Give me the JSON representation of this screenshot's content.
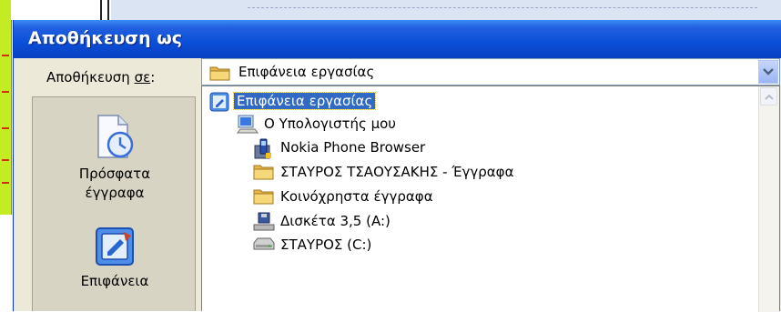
{
  "dialog": {
    "title": "Αποθήκευση ως",
    "save_in": {
      "label_prefix": "Αποθήκευση ",
      "label_accel": "σε",
      "label_suffix": ":",
      "selected_value": "Επιφάνεια εργασίας"
    }
  },
  "places": [
    {
      "label_line1": "Πρόσφατα",
      "label_line2": "έγγραφα",
      "icon": "recent-documents-icon"
    },
    {
      "label_line1": "Επιφάνεια",
      "icon": "desktop-icon"
    }
  ],
  "dropdown": {
    "items": [
      {
        "label": "Επιφάνεια εργασίας",
        "icon": "desktop-icon",
        "level": 0,
        "selected": true
      },
      {
        "label": "Ο Υπολογιστής μου",
        "icon": "my-computer-icon",
        "level": 1
      },
      {
        "label": "Nokia Phone Browser",
        "icon": "phone-browser-icon",
        "level": 2
      },
      {
        "label": "ΣΤΑΥΡΟΣ ΤΣΑΟΥΣΑΚΗΣ - Έγγραφα",
        "icon": "folder-icon",
        "level": 2
      },
      {
        "label": "Κοινόχρηστα έγγραφα",
        "icon": "folder-icon",
        "level": 2
      },
      {
        "label": "Δισκέτα 3,5 (A:)",
        "icon": "floppy-drive-icon",
        "level": 2
      },
      {
        "label": "ΣΤΑΥΡΟΣ (C:)",
        "icon": "hard-drive-icon",
        "level": 2
      }
    ]
  },
  "colors": {
    "titlebar": "#0a4fd8",
    "selection": "#316ac5",
    "dialog_bg": "#ece9d8"
  }
}
